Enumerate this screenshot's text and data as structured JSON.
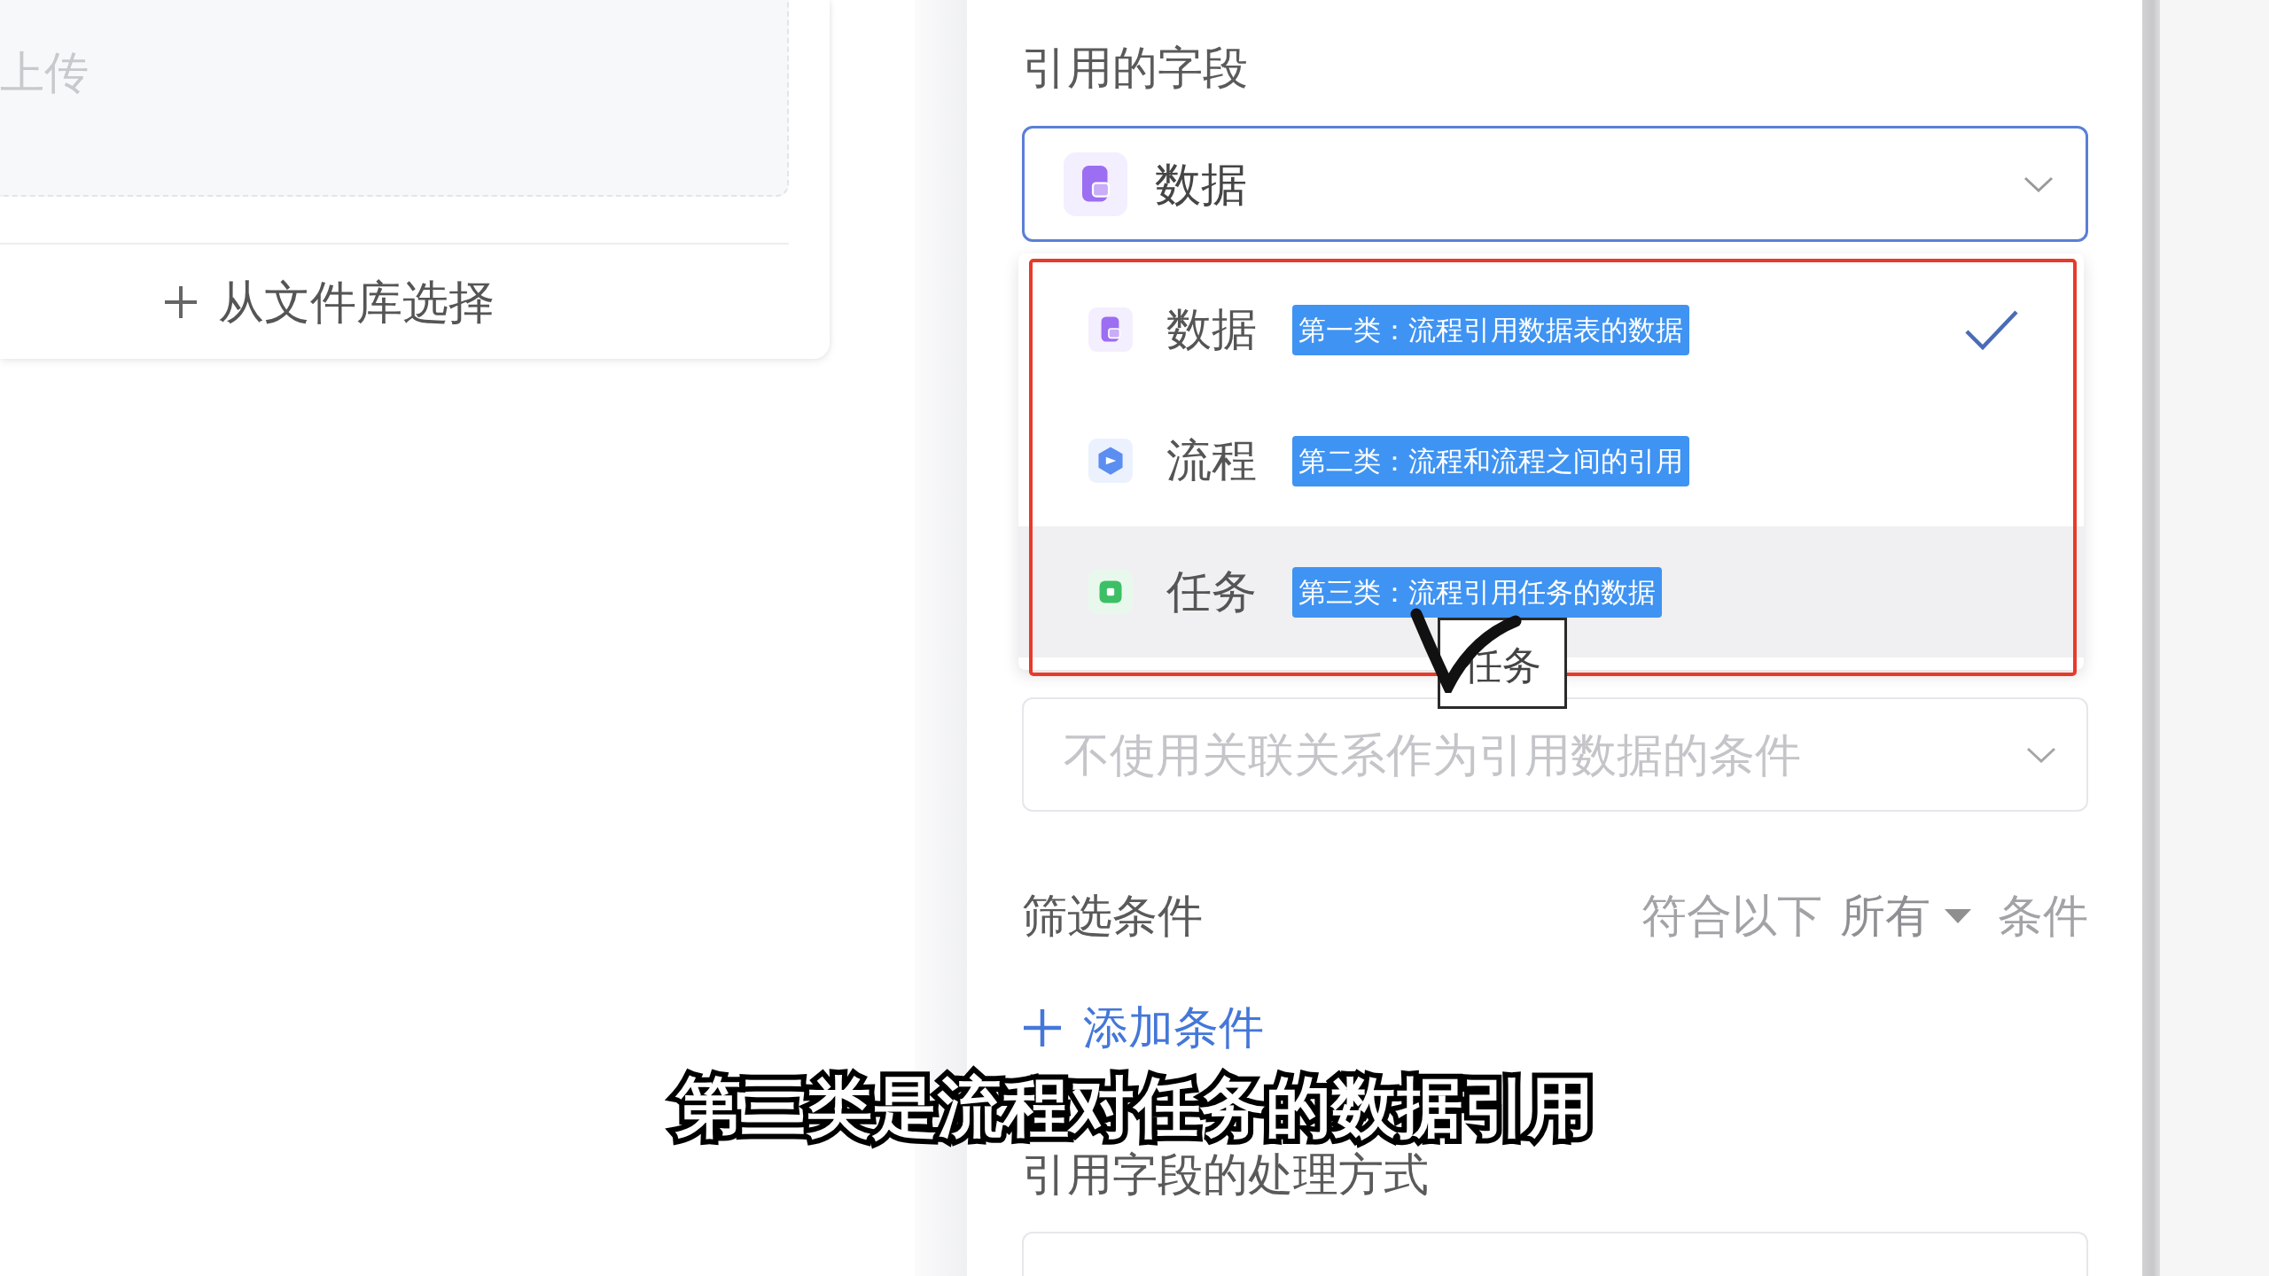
{
  "upload_card": {
    "upload_hint": "上传",
    "library_button": {
      "label": "从文件库选择"
    }
  },
  "field_panel": {
    "reference_field": {
      "label": "引用的字段",
      "value": "数据",
      "open": true,
      "options": [
        {
          "kind": "data",
          "label": "数据",
          "note": "第一类：流程引用数据表的数据",
          "selected": true,
          "hovered": false
        },
        {
          "kind": "process",
          "label": "流程",
          "note": "第二类：流程和流程之间的引用",
          "selected": false,
          "hovered": false
        },
        {
          "kind": "task",
          "label": "任务",
          "note": "第三类：流程引用任务的数据",
          "selected": false,
          "hovered": true
        }
      ]
    },
    "relation_condition": {
      "placeholder": "不使用关联关系作为引用数据的条件"
    },
    "filter": {
      "label": "筛选条件",
      "match_prefix": "符合以下",
      "match_mode": "所有",
      "match_suffix": "条件",
      "add_button": {
        "label": "添加条件"
      }
    },
    "processing": {
      "label": "引用字段的处理方式"
    }
  },
  "drag_preview": {
    "label": "任务"
  },
  "subtitle": "第三类是流程对任务的数据引用"
}
